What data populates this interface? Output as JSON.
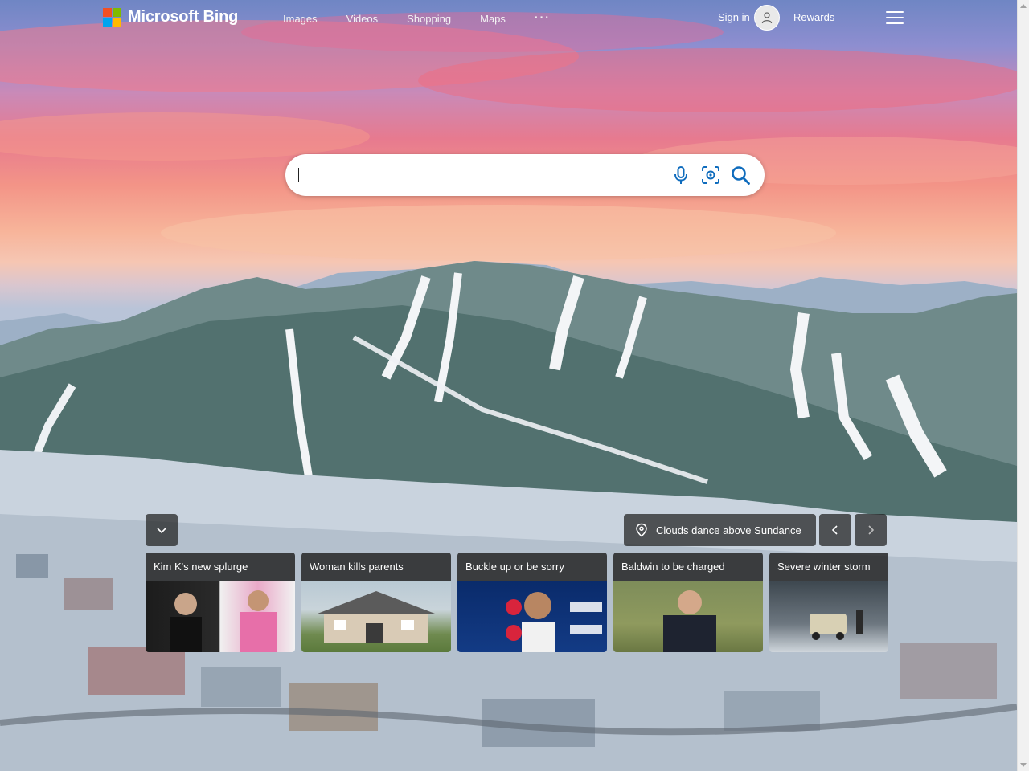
{
  "app": {
    "brand": "Microsoft Bing",
    "logo_colors": [
      "#f25022",
      "#7fba00",
      "#00a4ef",
      "#ffb900"
    ]
  },
  "nav": {
    "items": [
      {
        "label": "Images"
      },
      {
        "label": "Videos"
      },
      {
        "label": "Shopping"
      },
      {
        "label": "Maps"
      }
    ],
    "more_label": "···"
  },
  "account": {
    "signin_label": "Sign in",
    "rewards_label": "Rewards"
  },
  "search": {
    "value": "",
    "icons": [
      "microphone-icon",
      "visual-search-icon",
      "search-icon"
    ],
    "accent": "#0f6cbd"
  },
  "image_of_day": {
    "caption": "Clouds dance above Sundance"
  },
  "news": {
    "cards": [
      {
        "title": "Kim K's new splurge"
      },
      {
        "title": "Woman kills parents"
      },
      {
        "title": "Buckle up or be sorry"
      },
      {
        "title": "Baldwin to be charged"
      },
      {
        "title": "Severe winter storm"
      }
    ]
  }
}
